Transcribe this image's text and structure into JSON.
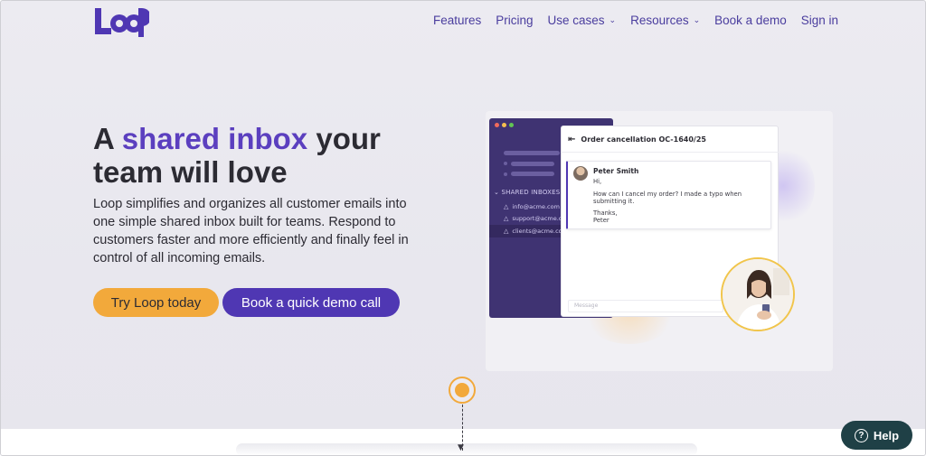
{
  "brand": {
    "logo_text": "LOOP"
  },
  "nav": {
    "items": [
      {
        "label": "Features",
        "dropdown": false
      },
      {
        "label": "Pricing",
        "dropdown": false
      },
      {
        "label": "Use cases",
        "dropdown": true
      },
      {
        "label": "Resources",
        "dropdown": true
      },
      {
        "label": "Book a demo",
        "dropdown": false
      },
      {
        "label": "Sign in",
        "dropdown": false
      }
    ]
  },
  "hero": {
    "headline_pre": "A ",
    "headline_accent": "shared inbox",
    "headline_post": " your team will love",
    "subtext": "Loop simplifies and organizes all customer emails into one simple shared inbox built for teams. Respond to customers faster and more efficiently and finally feel in control of all incoming emails.",
    "cta_primary": "Try Loop today",
    "cta_secondary": "Book a quick demo call"
  },
  "mockup": {
    "sidebar_heading": "SHARED INBOXES",
    "inboxes": [
      "info@acme.com",
      "support@acme.com",
      "clients@acme.com"
    ],
    "conversation_title": "Order cancellation OC-1640/25",
    "message": {
      "sender": "Peter Smith",
      "greeting": "Hi,",
      "body_line1": "How can I cancel my order? I made a typo when",
      "body_line2": "submitting it.",
      "signoff1": "Thanks,",
      "signoff2": "Peter"
    },
    "input_placeholder": "Message"
  },
  "help": {
    "label": "Help"
  },
  "colors": {
    "accent_purple": "#4f37b3",
    "accent_orange": "#f2a93b",
    "help_bg": "#1f4046"
  }
}
